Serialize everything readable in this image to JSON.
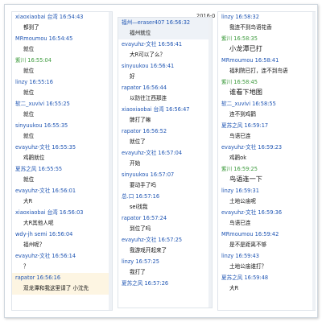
{
  "date_fragment": "2016-0",
  "columns": [
    {
      "messages": [
        {
          "sender": "xiaoxiaobai 台湾",
          "time": "16:54:43",
          "text": "都到了",
          "green": false,
          "style": ""
        },
        {
          "sender": "MRmoumou",
          "time": "16:54:45",
          "text": "就位",
          "green": false,
          "style": ""
        },
        {
          "sender": "紫川",
          "time": "16:55:04",
          "text": "就位",
          "green": true,
          "style": ""
        },
        {
          "sender": "linzy",
          "time": "16:55:16",
          "text": "就位",
          "green": false,
          "style": ""
        },
        {
          "sender": "软二_xuvivi",
          "time": "16:55:25",
          "text": "就位",
          "green": false,
          "style": ""
        },
        {
          "sender": "sinyuukou",
          "time": "16:55:35",
          "text": "就位",
          "green": false,
          "style": ""
        },
        {
          "sender": "evayuhz-文社",
          "time": "16:55:35",
          "text": "鸡鹳就位",
          "green": false,
          "style": ""
        },
        {
          "sender": "夏苏之风",
          "time": "16:55:55",
          "text": "就位",
          "green": false,
          "style": ""
        },
        {
          "sender": "evayuhz-文社",
          "time": "16:56:01",
          "text": "大R",
          "green": false,
          "style": ""
        },
        {
          "sender": "xiaoxiaobai 台湾",
          "time": "16:56:03",
          "text": "大R其他人呢",
          "green": false,
          "style": ""
        },
        {
          "sender": "wdy-jh semi",
          "time": "16:56:04",
          "text": "福州呢？",
          "green": false,
          "style": ""
        },
        {
          "sender": "evayuhz-文社",
          "time": "16:56:14",
          "text": "？",
          "green": false,
          "style": ""
        },
        {
          "sender": "rapator",
          "time": "16:56:16",
          "text": "双龙潭和我这里请了 小沈先",
          "green": false,
          "style": "hl"
        }
      ]
    },
    {
      "messages": [
        {
          "sender": "福州—eraser407",
          "time": "16:56:32",
          "text": "福州就位",
          "green": false,
          "style": "bar"
        },
        {
          "sender": "evayuhz-文社",
          "time": "16:56:41",
          "text": "大R可以了么？",
          "green": false,
          "style": ""
        },
        {
          "sender": "sinyuukou",
          "time": "16:56:41",
          "text": "好",
          "green": false,
          "style": ""
        },
        {
          "sender": "rapator",
          "time": "16:56:44",
          "text": "以防往江西那连",
          "green": false,
          "style": ""
        },
        {
          "sender": "xiaoxiaobai 台湾",
          "time": "16:56:47",
          "text": "髀打了嘛",
          "green": false,
          "style": ""
        },
        {
          "sender": "rapator",
          "time": "16:56:52",
          "text": "就位了",
          "green": false,
          "style": ""
        },
        {
          "sender": "evayuhz-文社",
          "time": "16:57:04",
          "text": "开始",
          "green": false,
          "style": ""
        },
        {
          "sender": "sinyuukou",
          "time": "16:57:07",
          "text": "要动手了吗",
          "green": false,
          "style": ""
        },
        {
          "sender": "总.口",
          "time": "16:57:16",
          "text": "sei找我",
          "green": false,
          "style": ""
        },
        {
          "sender": "rapator",
          "time": "16:57:24",
          "text": "到位了吗",
          "green": false,
          "style": ""
        },
        {
          "sender": "evayuhz-文社",
          "time": "16:57:25",
          "text": "我游戏开起来了",
          "green": false,
          "style": ""
        },
        {
          "sender": "linzy",
          "time": "16:57:25",
          "text": "我打了",
          "green": false,
          "style": ""
        },
        {
          "sender": "夏苏之风",
          "time": "16:57:26",
          "text": "",
          "green": false,
          "style": ""
        }
      ]
    },
    {
      "messages": [
        {
          "sender": "linzy",
          "time": "16:58:32",
          "text": "我连不到鸟语花香",
          "green": false,
          "style": ""
        },
        {
          "sender": "紫川",
          "time": "16:58:35",
          "text": "小龙潭已打",
          "green": true,
          "style": "big"
        },
        {
          "sender": "MRmoumou",
          "time": "16:58:41",
          "text": "福利院已打，连不到鸟语",
          "green": false,
          "style": ""
        },
        {
          "sender": "紫川",
          "time": "16:58:45",
          "text": "谁看下地图",
          "green": true,
          "style": "big"
        },
        {
          "sender": "软二_xuvivi",
          "time": "16:58:55",
          "text": "连不到鸡鹳",
          "green": false,
          "style": ""
        },
        {
          "sender": "夏苏之风",
          "time": "16:59:17",
          "text": "鸟语已连",
          "green": false,
          "style": ""
        },
        {
          "sender": "evayuhz-文社",
          "time": "16:59:23",
          "text": "鸡鹳ok",
          "green": false,
          "style": ""
        },
        {
          "sender": "紫川",
          "time": "16:59:25",
          "text": "鸟语连一下",
          "green": true,
          "style": "big"
        },
        {
          "sender": "linzy",
          "time": "16:59:31",
          "text": "土地公庙呢",
          "green": false,
          "style": ""
        },
        {
          "sender": "evayuhz-文社",
          "time": "16:59:36",
          "text": "鸟语已连",
          "green": false,
          "style": ""
        },
        {
          "sender": "MRmoumou",
          "time": "16:59:42",
          "text": "是不是距离不够",
          "green": false,
          "style": ""
        },
        {
          "sender": "linzy",
          "time": "16:59:43",
          "text": "土地公庙谁打？",
          "green": false,
          "style": ""
        },
        {
          "sender": "夏苏之风",
          "time": "16:59:48",
          "text": "大R",
          "green": false,
          "style": ""
        }
      ]
    }
  ]
}
